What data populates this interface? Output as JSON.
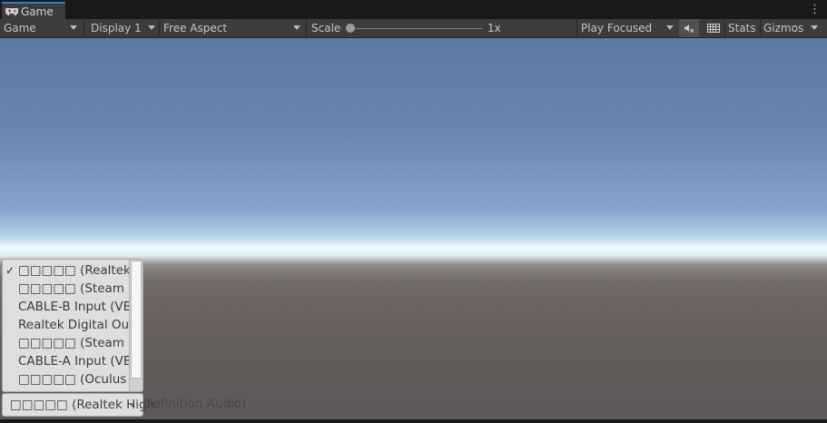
{
  "tab": {
    "label": "Game",
    "icon": "gamepad-icon"
  },
  "toolbar": {
    "mode": "Game",
    "display": "Display 1",
    "aspect": "Free Aspect",
    "scale_label": "Scale",
    "scale_value": "1x",
    "play_mode": "Play Focused",
    "stats": "Stats",
    "gizmos": "Gizmos"
  },
  "audio_devices": {
    "items": [
      "□□□□□ (Realtek High Definition Audio)",
      "□□□□□ (Steam Streaming Speakers)",
      "CABLE-B Input (VB-Audio Cable B)",
      "Realtek Digital Output (Realtek High Definition Audio)",
      "□□□□□ (Steam Streaming Microphone)",
      "CABLE-A Input (VB-Audio Cable A)",
      "□□□□□ (Oculus Virtual Audio Device)"
    ],
    "checked_index": 0,
    "selected_prefix": "□□□□□ (Realtek High",
    "selected_overflow": "Definition Audio)"
  },
  "colors": {
    "tab_accent": "#3a79bb",
    "toolbar_bg": "#3c3c3c",
    "sky_top": "#5c7aa3",
    "ground": "#655e5d"
  }
}
